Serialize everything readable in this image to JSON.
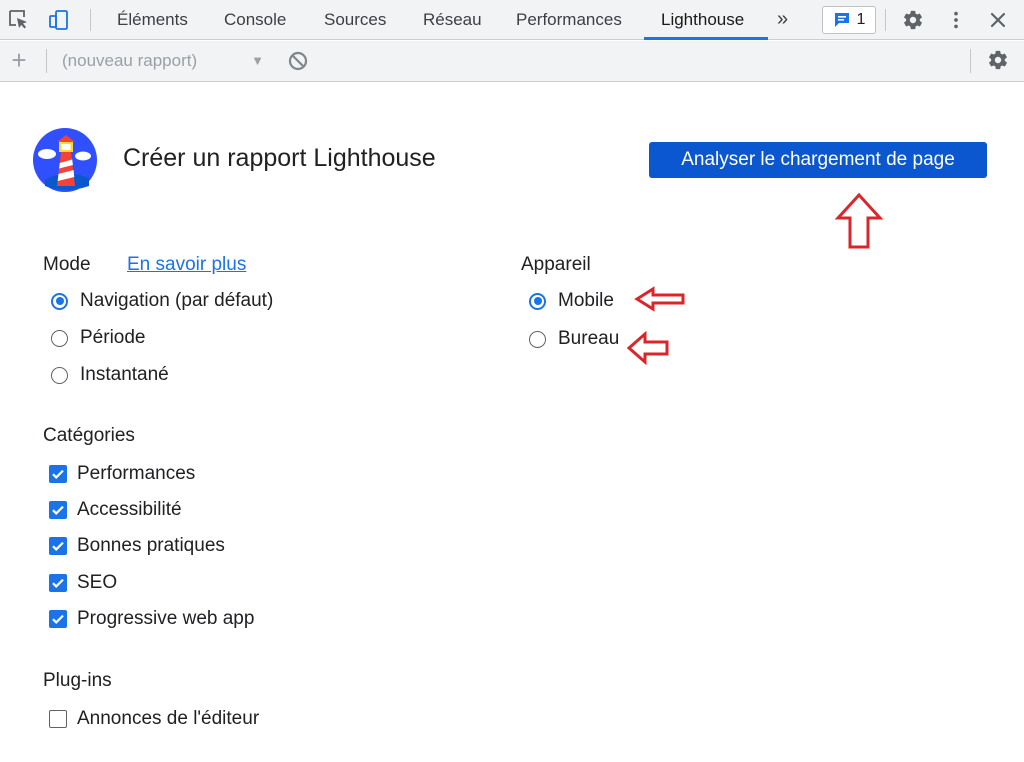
{
  "tabs": [
    {
      "label": "Éléments",
      "active": false
    },
    {
      "label": "Console",
      "active": false
    },
    {
      "label": "Sources",
      "active": false
    },
    {
      "label": "Réseau",
      "active": false
    },
    {
      "label": "Performances",
      "active": false
    },
    {
      "label": "Lighthouse",
      "active": true
    }
  ],
  "tab_more_label": "»",
  "issues_count": "1",
  "toolbar2": {
    "add_label": "+",
    "report_select_value": "(nouveau rapport)"
  },
  "title": "Créer un rapport Lighthouse",
  "analyze_button": "Analyser le chargement de page",
  "mode": {
    "label": "Mode",
    "learn_more": "En savoir plus",
    "options": [
      {
        "label": "Navigation (par défaut)",
        "checked": true
      },
      {
        "label": "Période",
        "checked": false
      },
      {
        "label": "Instantané",
        "checked": false
      }
    ]
  },
  "device": {
    "label": "Appareil",
    "options": [
      {
        "label": "Mobile",
        "checked": true
      },
      {
        "label": "Bureau",
        "checked": false
      }
    ]
  },
  "categories": {
    "label": "Catégories",
    "items": [
      {
        "label": "Performances",
        "checked": true
      },
      {
        "label": "Accessibilité",
        "checked": true
      },
      {
        "label": "Bonnes pratiques",
        "checked": true
      },
      {
        "label": "SEO",
        "checked": true
      },
      {
        "label": "Progressive web app",
        "checked": true
      }
    ]
  },
  "plugins": {
    "label": "Plug-ins",
    "items": [
      {
        "label": "Annonces de l'éditeur",
        "checked": false
      }
    ]
  },
  "colors": {
    "accent": "#1a73e8",
    "button_bg": "#0b57d0",
    "annotation_red": "#d9262b"
  },
  "icons": [
    "inspect-element-icon",
    "device-toggle-icon",
    "issues-icon",
    "gear-icon",
    "kebab-menu-icon",
    "close-icon",
    "block-icon",
    "lighthouse-logo"
  ]
}
